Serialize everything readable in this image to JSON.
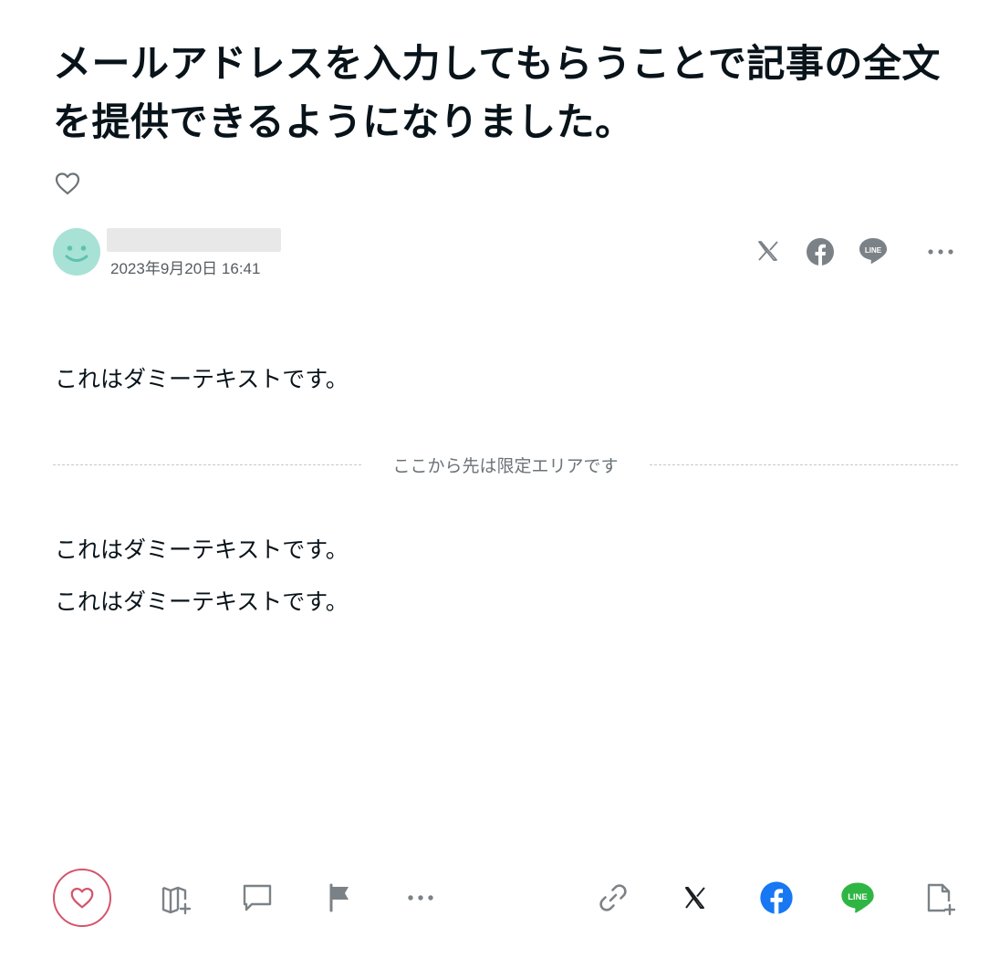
{
  "article": {
    "title": "メールアドレスを入力してもらうことで記事の全文を提供できるようになりました。",
    "author_name": "",
    "date": "2023年9月20日 16:41",
    "paragraph_free": "これはダミーテキストです。",
    "paywall_label": "ここから先は限定エリアです",
    "paragraphs_paid": [
      "これはダミーテキストです。",
      "これはダミーテキストです。"
    ]
  },
  "icons": {
    "like_top": "heart-icon",
    "avatar": "smiley-avatar",
    "share_top": [
      "x-icon",
      "facebook-icon",
      "line-icon",
      "more-icon"
    ],
    "bottom_left": [
      "heart-icon",
      "magazine-add-icon",
      "comment-icon",
      "flag-icon",
      "more-icon"
    ],
    "bottom_right": [
      "link-icon",
      "x-icon",
      "facebook-icon",
      "line-icon",
      "embed-add-icon"
    ],
    "line_glyph_label": "LINE"
  },
  "colors": {
    "avatar_bg": "#a8e2d6",
    "avatar_face": "#5fc2ad",
    "like_accent": "#d4556c",
    "facebook": "#1877f2",
    "line": "#2fb543",
    "icon_gray": "#7b8287",
    "text": "#08131a"
  }
}
